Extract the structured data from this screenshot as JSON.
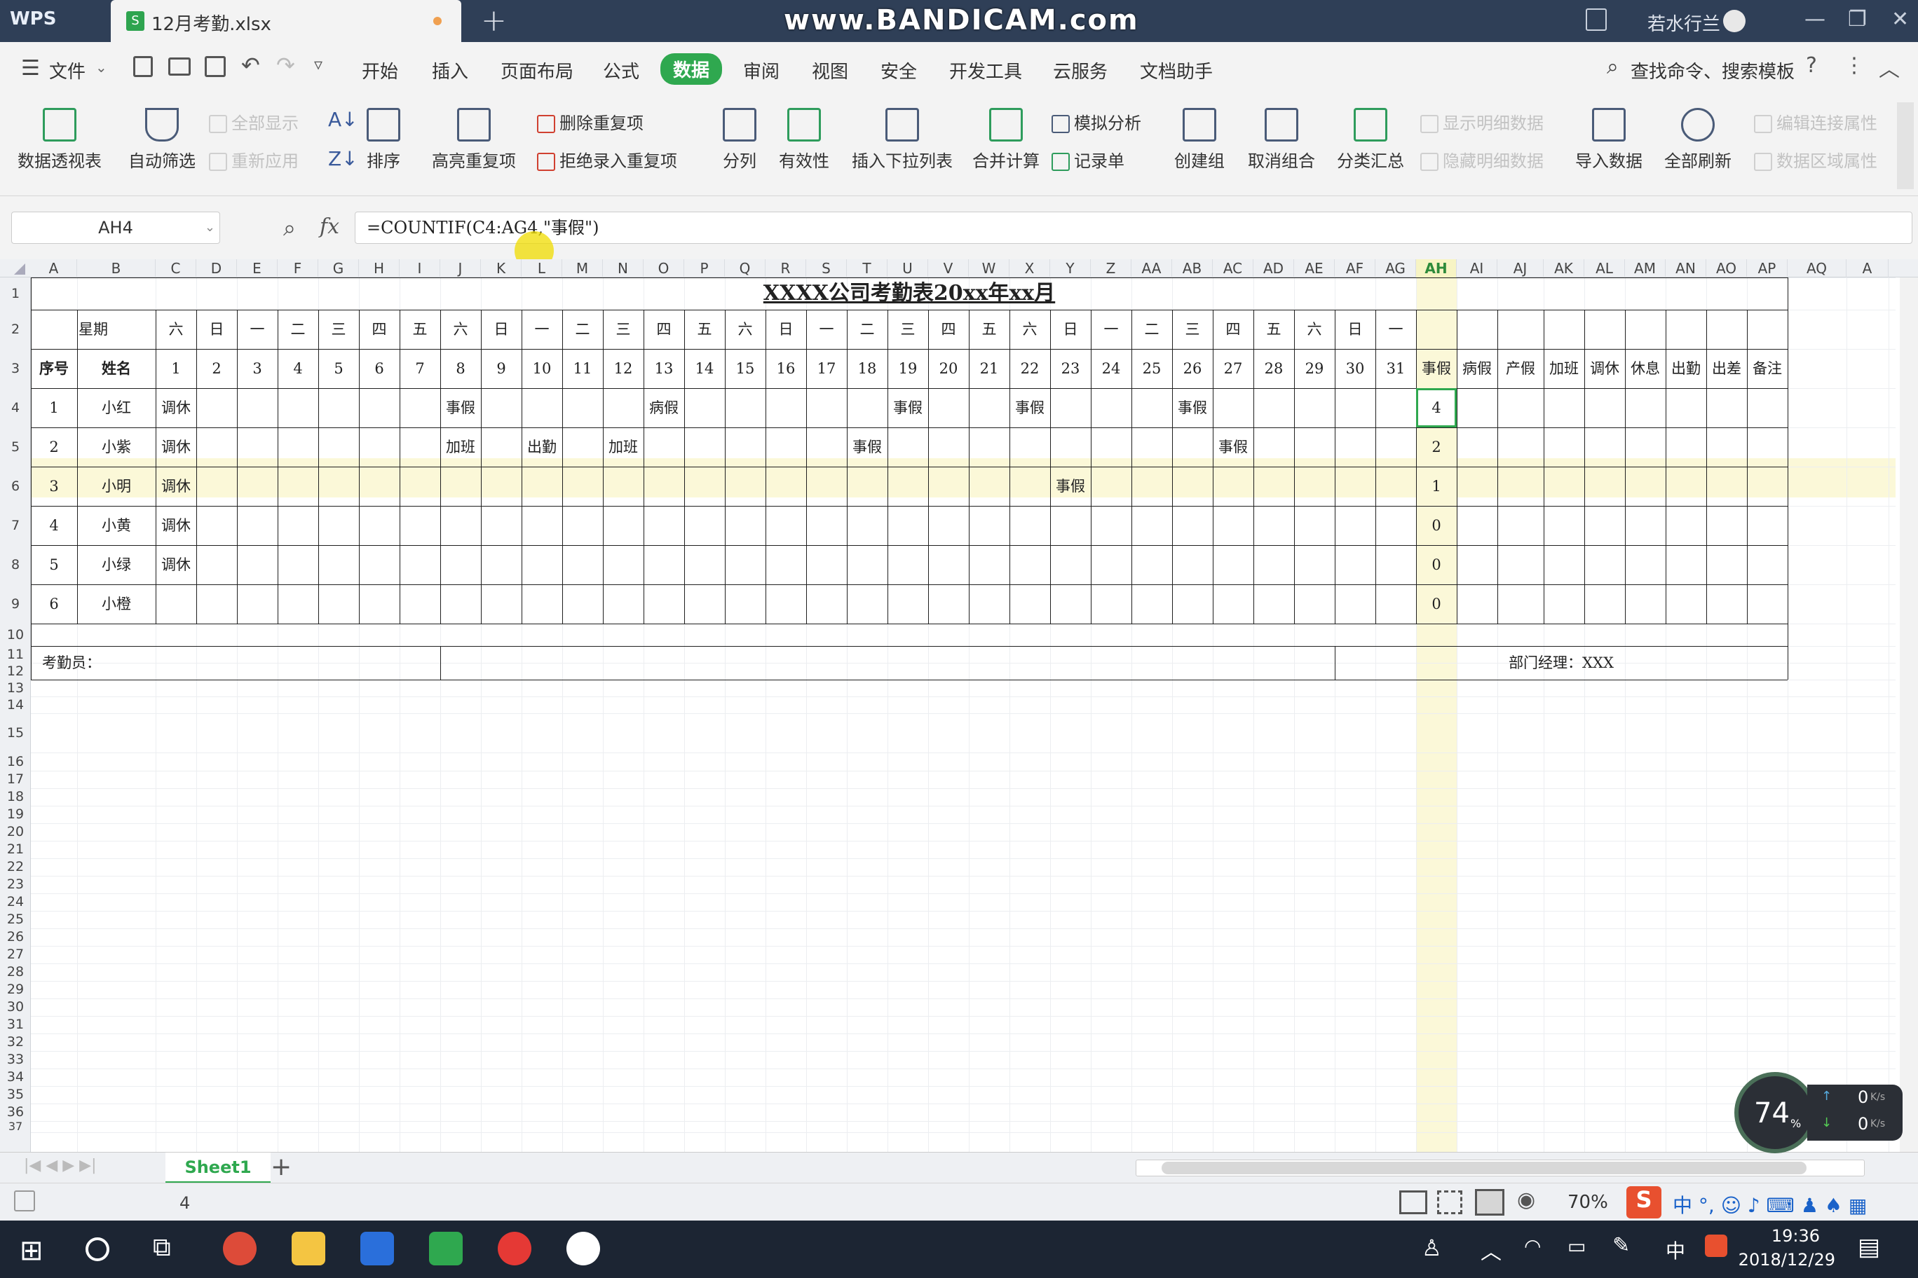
{
  "titlebar": {
    "app": "WPS",
    "file_tab": "12月考勤.xlsx",
    "new_tab": "+",
    "watermark": "www.BANDICAM.com",
    "user": "若水行兰"
  },
  "menus": [
    "文件",
    "开始",
    "插入",
    "页面布局",
    "公式",
    "数据",
    "审阅",
    "视图",
    "安全",
    "开发工具",
    "云服务",
    "文档助手"
  ],
  "active_menu": "数据",
  "search_label": "查找命令、搜索模板",
  "ribbon": {
    "pivot": "数据透视表",
    "autofilter": "自动筛选",
    "show_all": "全部显示",
    "reapply": "重新应用",
    "sort": "排序",
    "highlight_dup": "高亮重复项",
    "remove_dup": "删除重复项",
    "reject_dup": "拒绝录入重复项",
    "split": "分列",
    "validity": "有效性",
    "insert_dropdown": "插入下拉列表",
    "consolidate": "合并计算",
    "whatif": "模拟分析",
    "record_form": "记录单",
    "group": "创建组",
    "ungroup": "取消组合",
    "subtotal": "分类汇总",
    "show_detail": "显示明细数据",
    "hide_detail": "隐藏明细数据",
    "import": "导入数据",
    "refresh_all": "全部刷新",
    "edit_links": "编辑连接属性",
    "range_props": "数据区域属性"
  },
  "formula_bar": {
    "name_box": "AH4",
    "fx": "fx",
    "formula": "=COUNTIF(C4:AG4,\"事假\")"
  },
  "columns": [
    "A",
    "B",
    "C",
    "D",
    "E",
    "F",
    "G",
    "H",
    "I",
    "J",
    "K",
    "L",
    "M",
    "N",
    "O",
    "P",
    "Q",
    "R",
    "S",
    "T",
    "U",
    "V",
    "W",
    "X",
    "Y",
    "Z",
    "AA",
    "AB",
    "AC",
    "AD",
    "AE",
    "AF",
    "AG",
    "AH",
    "AI",
    "AJ",
    "AK",
    "AL",
    "AM",
    "AN",
    "AO",
    "AP",
    "AQ",
    "A"
  ],
  "selected_column": "AH",
  "rows": [
    "1",
    "2",
    "3",
    "4",
    "5",
    "6",
    "7",
    "8",
    "9",
    "10",
    "11",
    "12",
    "13",
    "14",
    "15",
    "16",
    "17",
    "18",
    "19",
    "20",
    "21",
    "22",
    "23",
    "24",
    "25",
    "26",
    "27",
    "28",
    "29",
    "30",
    "31",
    "32",
    "33",
    "34",
    "35",
    "36",
    "37"
  ],
  "sheet": {
    "title": "XXXX公司考勤表20xx年xx月",
    "weekday_label": "星期",
    "weekdays": [
      "六",
      "日",
      "一",
      "二",
      "三",
      "四",
      "五",
      "六",
      "日",
      "一",
      "二",
      "三",
      "四",
      "五",
      "六",
      "日",
      "一",
      "二",
      "三",
      "四",
      "五",
      "六",
      "日",
      "一",
      "二",
      "三",
      "四",
      "五",
      "六",
      "日",
      "一"
    ],
    "header_no": "序号",
    "header_name": "姓名",
    "days": [
      "1",
      "2",
      "3",
      "4",
      "5",
      "6",
      "7",
      "8",
      "9",
      "10",
      "11",
      "12",
      "13",
      "14",
      "15",
      "16",
      "17",
      "18",
      "19",
      "20",
      "21",
      "22",
      "23",
      "24",
      "25",
      "26",
      "27",
      "28",
      "29",
      "30",
      "31"
    ],
    "summary_headers": [
      "事假",
      "病假",
      "产假",
      "加班",
      "调休",
      "休息",
      "出勤",
      "出差",
      "备注"
    ],
    "people": [
      {
        "no": "1",
        "name": "小红",
        "marks": [
          [
            "C",
            "调休"
          ],
          [
            "J",
            "事假"
          ],
          [
            "O",
            "病假"
          ],
          [
            "U",
            "事假"
          ],
          [
            "X",
            "事假"
          ],
          [
            "AB",
            "事假"
          ]
        ],
        "leave": "4"
      },
      {
        "no": "2",
        "name": "小紫",
        "marks": [
          [
            "C",
            "调休"
          ],
          [
            "J",
            "加班"
          ],
          [
            "L",
            "出勤"
          ],
          [
            "N",
            "加班"
          ],
          [
            "T",
            "事假"
          ],
          [
            "AC",
            "事假"
          ]
        ],
        "leave": "2"
      },
      {
        "no": "3",
        "name": "小明",
        "marks": [
          [
            "C",
            "调休"
          ],
          [
            "Y",
            "事假"
          ]
        ],
        "leave": "1"
      },
      {
        "no": "4",
        "name": "小黄",
        "marks": [
          [
            "C",
            "调休"
          ]
        ],
        "leave": "0"
      },
      {
        "no": "5",
        "name": "小绿",
        "marks": [
          [
            "C",
            "调休"
          ]
        ],
        "leave": "0"
      },
      {
        "no": "6",
        "name": "小橙",
        "marks": [],
        "leave": "0"
      }
    ],
    "clerk": "考勤员：",
    "manager": "部门经理：XXX"
  },
  "sheet_tab": "Sheet1",
  "status": {
    "value": "4",
    "zoom": "70%"
  },
  "speed": {
    "percent": "74",
    "unit": "%",
    "up": "0",
    "down": "0",
    "rate_unit": "K/s"
  },
  "taskbar": {
    "time": "19:36",
    "date": "2018/12/29",
    "ime": "中"
  },
  "colors": {
    "accent": "#2fa84f",
    "highlight_row": "#fbf8d8",
    "title_bar": "#2f3f57",
    "taskbar": "#1c2533"
  }
}
